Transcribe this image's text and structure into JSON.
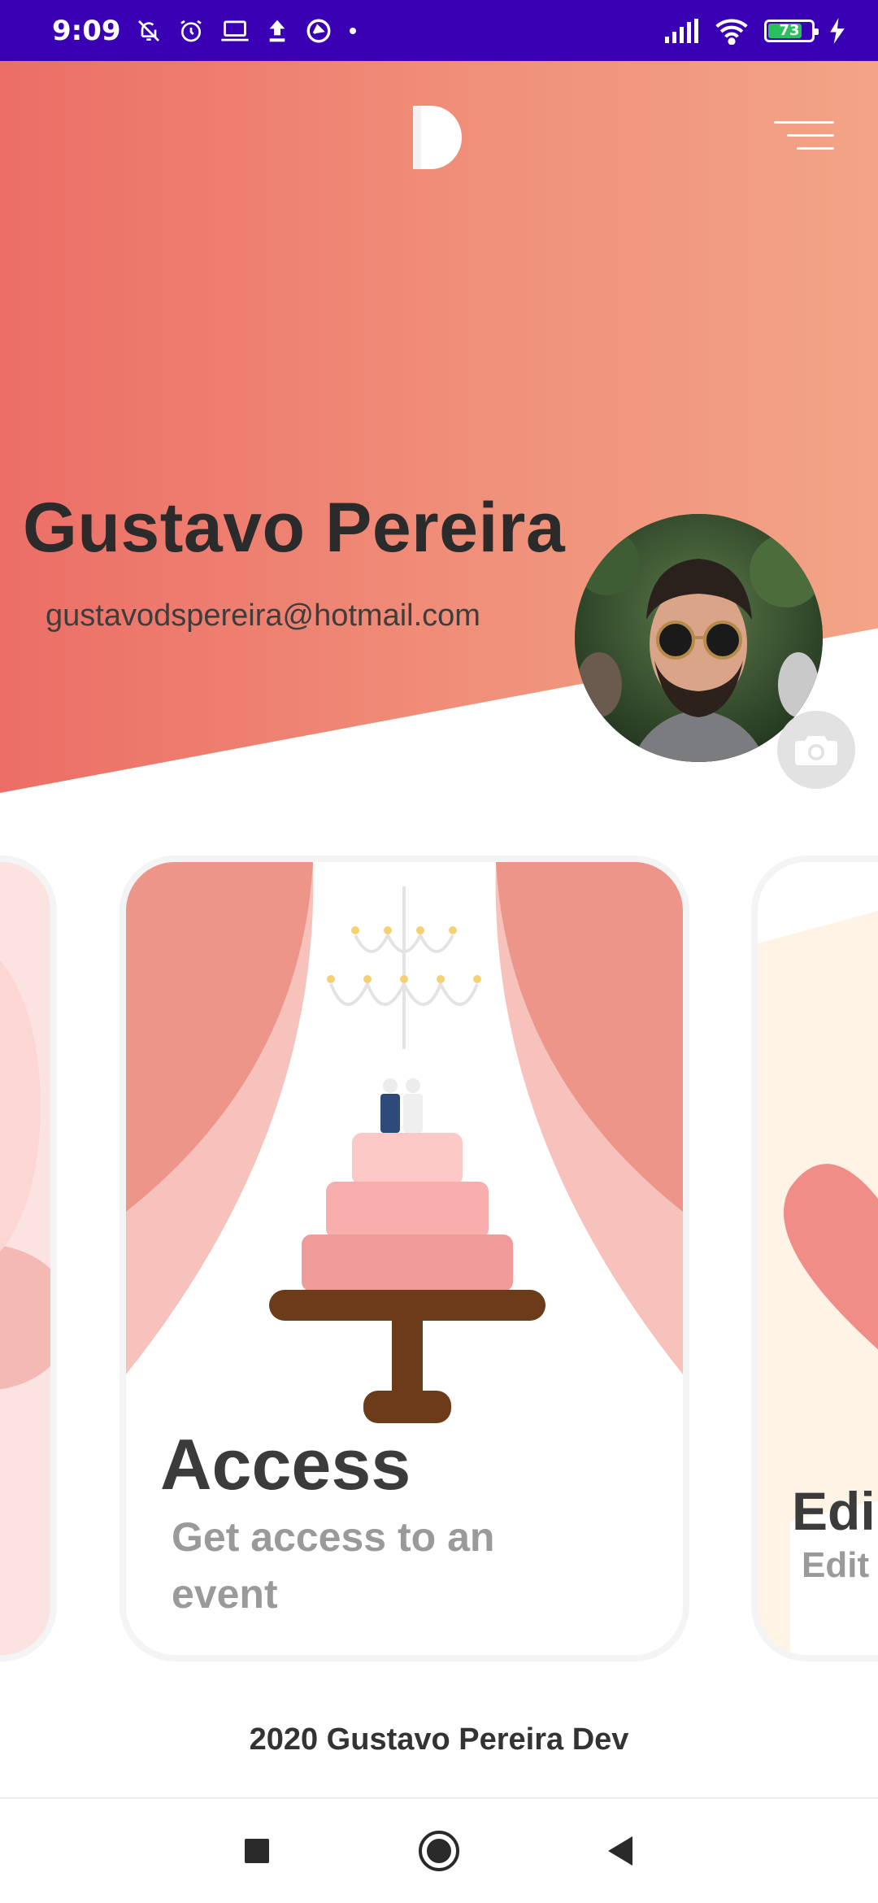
{
  "status_bar": {
    "time": "9:09",
    "battery": "73",
    "battery_level": 0.73,
    "left_icons": [
      "bell-off-icon",
      "alarm-icon",
      "laptop-icon",
      "upload-icon",
      "sync-icon",
      "dot-icon"
    ],
    "right_icons": [
      "signal-icon",
      "wifi-icon",
      "battery-icon",
      "charging-icon"
    ]
  },
  "header": {
    "logo": "app-logo",
    "menu_icon": "hamburger-menu-icon",
    "gradient_start": "#ec6e66",
    "gradient_end": "#f3a486"
  },
  "profile": {
    "name": "Gustavo Pereira",
    "email": "gustavodspereira@hotmail.com",
    "camera_icon": "camera-icon"
  },
  "cards": [
    {
      "id": "left",
      "title": "",
      "subtitle": ""
    },
    {
      "id": "access",
      "title": "Access",
      "subtitle": "Get access to an event",
      "illustration": "wedding-cake-illustration"
    },
    {
      "id": "edit",
      "title": "Edi",
      "subtitle": "Edit",
      "illustration": "heart-illustration"
    }
  ],
  "footer": {
    "text": "2020 Gustavo Pereira Dev"
  },
  "nav": {
    "recents": "square-icon",
    "home": "circle-icon",
    "back": "triangle-back-icon"
  },
  "colors": {
    "status_bar": "#3a00b3",
    "accent": "#ec6e66",
    "cake_base": "#6b3b1a"
  }
}
